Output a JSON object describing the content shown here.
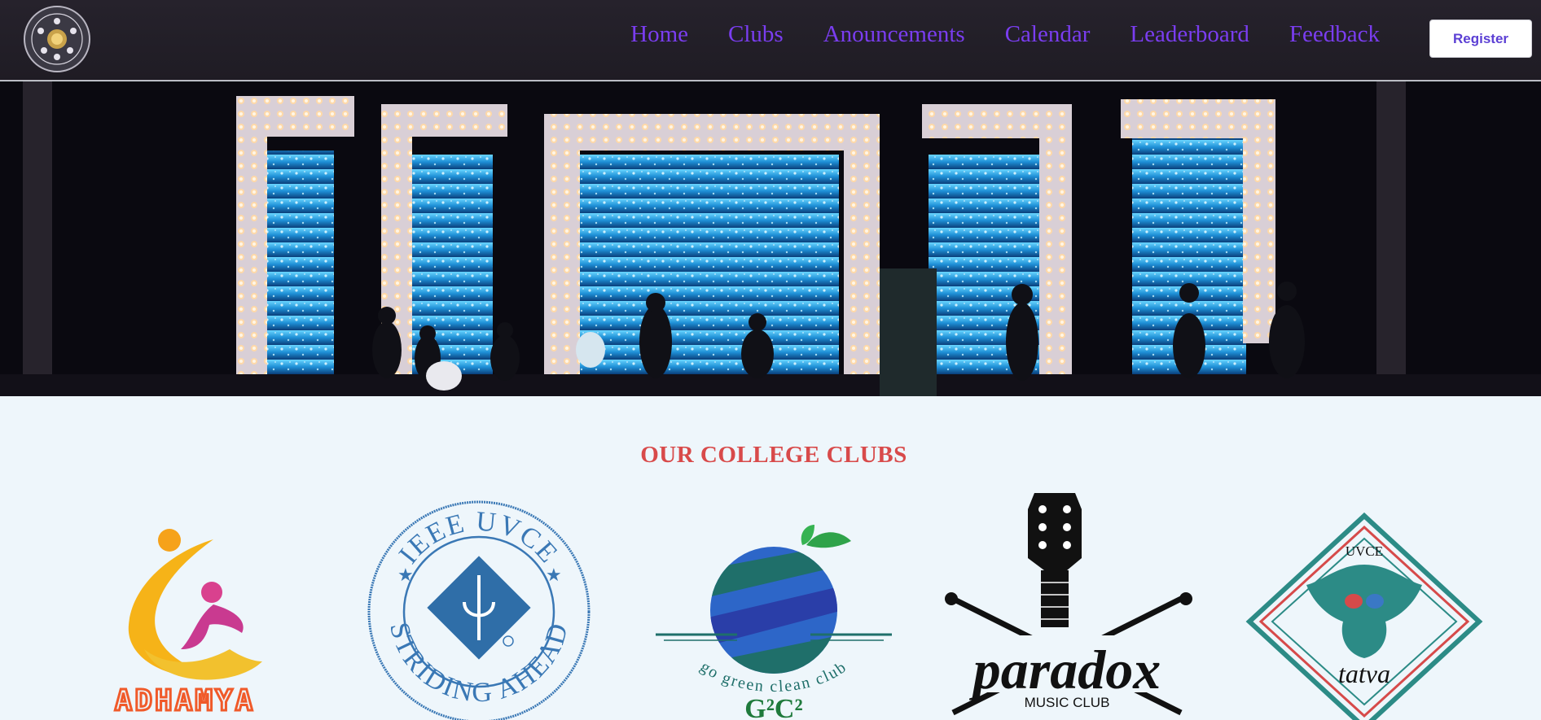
{
  "nav": {
    "logo_name": "college-emblem-logo",
    "links": [
      "Home",
      "Clubs",
      "Anouncements",
      "Calendar",
      "Leaderboard",
      "Feedback"
    ],
    "register_label": "Register"
  },
  "hero": {
    "alt": "Concert stage banner"
  },
  "clubs": {
    "title": "OUR COLLEGE CLUBS",
    "items": [
      {
        "name": "Adhamya",
        "logo_text": "ADHAMYA"
      },
      {
        "name": "IEEE UVCE",
        "logo_text_top": "IEEE UVCE",
        "logo_text_bottom": "STRIDING AHEAD"
      },
      {
        "name": "G2C2",
        "logo_text": "go green clean club"
      },
      {
        "name": "Paradox",
        "logo_text": "paradox",
        "logo_subtext": "MUSIC CLUB"
      },
      {
        "name": "Tatva",
        "logo_text_top": "UVCE",
        "logo_text": "tatva"
      }
    ]
  },
  "colors": {
    "nav_bg": "#26222c",
    "nav_link": "#7a3df0",
    "register_text": "#5b3fd4",
    "page_bg": "#eef6fb",
    "title_red": "#d84a4a"
  }
}
